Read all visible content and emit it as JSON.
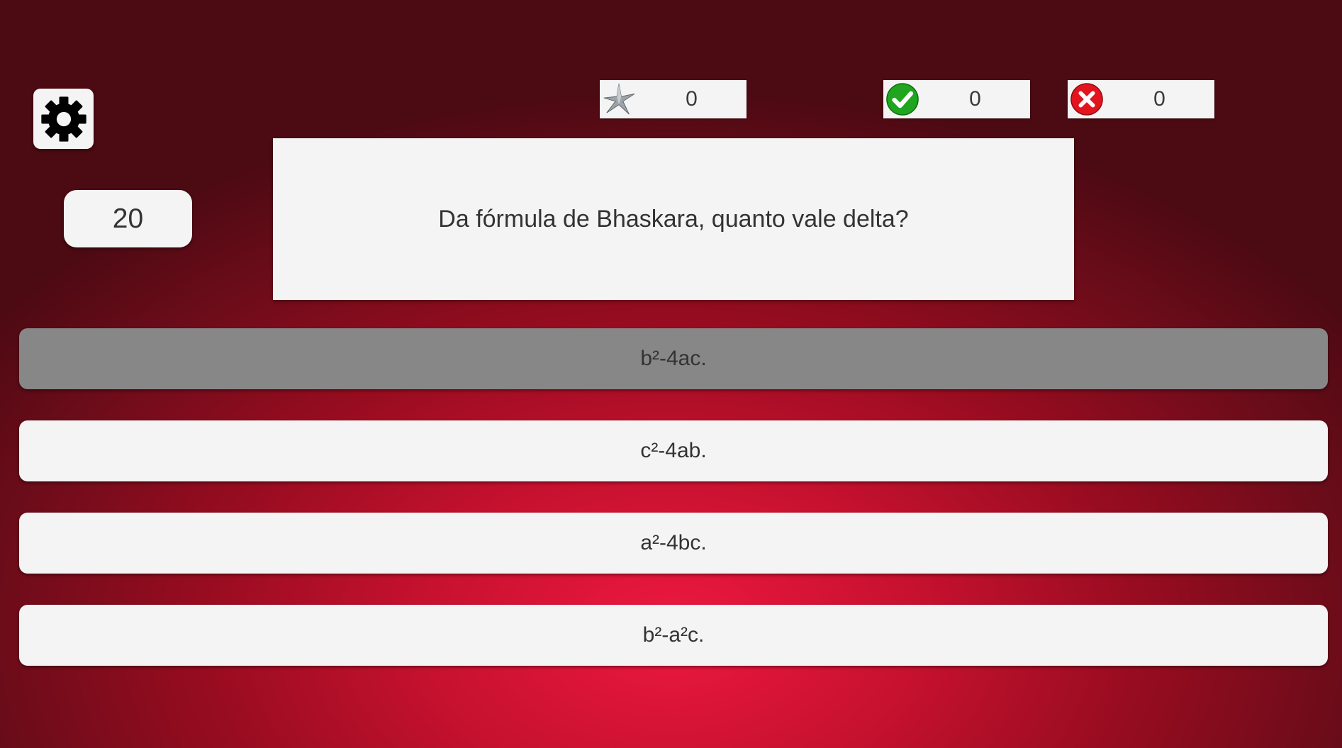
{
  "header": {
    "settings_icon": "gear-icon",
    "timer": "20"
  },
  "scores": {
    "stars": {
      "icon": "star-icon",
      "value": "0"
    },
    "correct": {
      "icon": "check-circle-icon",
      "value": "0",
      "color": "#1fa51f"
    },
    "wrong": {
      "icon": "x-circle-icon",
      "value": "0",
      "color": "#e2141e"
    }
  },
  "question": {
    "text": "Da fórmula de Bhaskara, quanto vale delta?"
  },
  "answers": [
    {
      "label": "b²-4ac.",
      "state": "selected"
    },
    {
      "label": "c²-4ab."
    },
    {
      "label": "a²-4bc."
    },
    {
      "label": "b²-a²c."
    }
  ],
  "colors": {
    "background_center": "#ee1840",
    "background_edge": "#4c0a12",
    "panel": "#f4f4f4",
    "selected_answer": "#888787"
  }
}
